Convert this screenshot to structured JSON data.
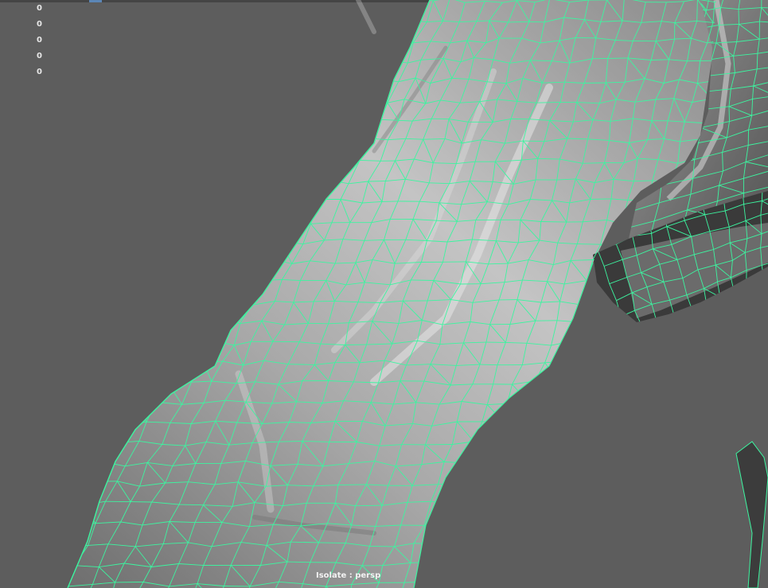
{
  "hud": {
    "values": [
      "0",
      "0",
      "0",
      "0",
      "0"
    ]
  },
  "viewport": {
    "camera_label": "Isolate : persp",
    "background_color": "#5d5d5d",
    "wireframe_color": "#3cf5a0",
    "shading": "smooth-shaded-with-wireframe",
    "object": "isolated-mesh"
  },
  "icons": {
    "selected_tool_marker": "top-strip-selected-icon"
  }
}
